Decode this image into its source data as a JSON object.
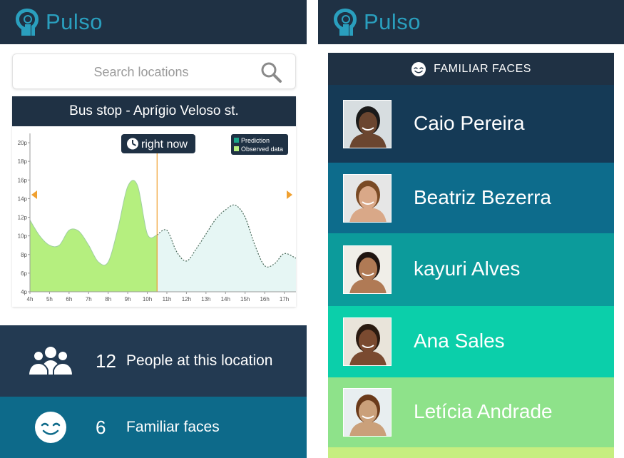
{
  "left": {
    "app_title": "Pulso",
    "search": {
      "placeholder": "Search locations"
    },
    "chart_card": {
      "title": "Bus stop  -  Aprígio Veloso st.",
      "now_label": "right now",
      "legend": {
        "prediction": "Prediction",
        "observed": "Observed data"
      }
    },
    "stats": {
      "people": {
        "count": "12",
        "label": "People at this location"
      },
      "faces": {
        "count": "6",
        "label": "Familiar faces"
      }
    }
  },
  "right": {
    "app_title": "Pulso",
    "header": "FAMILIAR FACES",
    "people": [
      {
        "name": "Caio Pereira",
        "color": "#153a56"
      },
      {
        "name": "Beatriz Bezerra",
        "color": "#0d6c8c"
      },
      {
        "name": "kayuri Alves",
        "color": "#0c9b9b"
      },
      {
        "name": "Ana Sales",
        "color": "#0bcfaa"
      },
      {
        "name": "Letícia Andrade",
        "color": "#8ee28a"
      }
    ]
  },
  "colors": {
    "navy": "#1f3144",
    "accent": "#2a9fbe",
    "observed_fill": "#b5ef7f",
    "prediction_fill": "#e6f6f4",
    "now_line": "#f0a030"
  },
  "chart_data": {
    "type": "area",
    "x_ticks": [
      "4h",
      "5h",
      "6h",
      "7h",
      "8h",
      "9h",
      "10h",
      "11h",
      "12h",
      "13h",
      "14h",
      "15h",
      "16h",
      "17h"
    ],
    "y_ticks": [
      "4p",
      "6p",
      "8p",
      "10p",
      "12p",
      "14p",
      "16p",
      "18p",
      "20p"
    ],
    "ylim": [
      4,
      21
    ],
    "xlim": [
      4,
      17.6
    ],
    "now": 10.5,
    "series": [
      {
        "name": "Observed data",
        "x": [
          4,
          4.5,
          5,
          5.5,
          6,
          6.5,
          7,
          7.5,
          8,
          8.5,
          9,
          9.5,
          10,
          10.5
        ],
        "values": [
          11.7,
          10,
          9,
          9,
          10.6,
          10.5,
          9,
          7.2,
          7.2,
          10.8,
          15.3,
          15.4,
          10.2,
          10.1
        ]
      },
      {
        "name": "Prediction",
        "x": [
          10.5,
          11,
          11.5,
          12,
          12.5,
          13,
          13.5,
          14,
          14.5,
          15,
          15.5,
          16,
          16.5,
          17,
          17.6
        ],
        "values": [
          10.1,
          10.6,
          8.3,
          7.3,
          8.6,
          10.2,
          11.8,
          12.8,
          13.3,
          12,
          9,
          6.8,
          7,
          8.1,
          7.6
        ]
      }
    ]
  }
}
